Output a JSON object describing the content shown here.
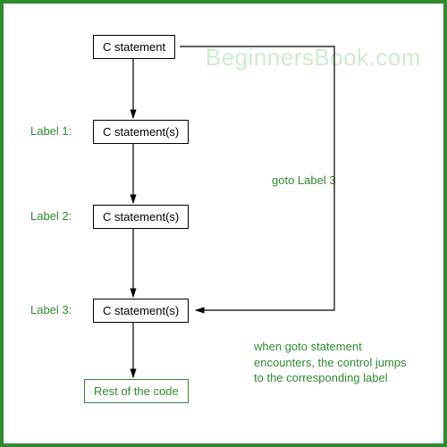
{
  "watermark": "BeginnersBook.com",
  "boxes": {
    "b1": "C statement",
    "b2": "C statement(s)",
    "b3": "C statement(s)",
    "b4": "C statement(s)",
    "b5": "Rest of the code"
  },
  "labels": {
    "l1": "Label 1:",
    "l2": "Label 2:",
    "l3": "Label 3:"
  },
  "gotoText": "goto Label 3",
  "note": "when goto statement\nencounters, the control jumps\nto the corresponding label"
}
